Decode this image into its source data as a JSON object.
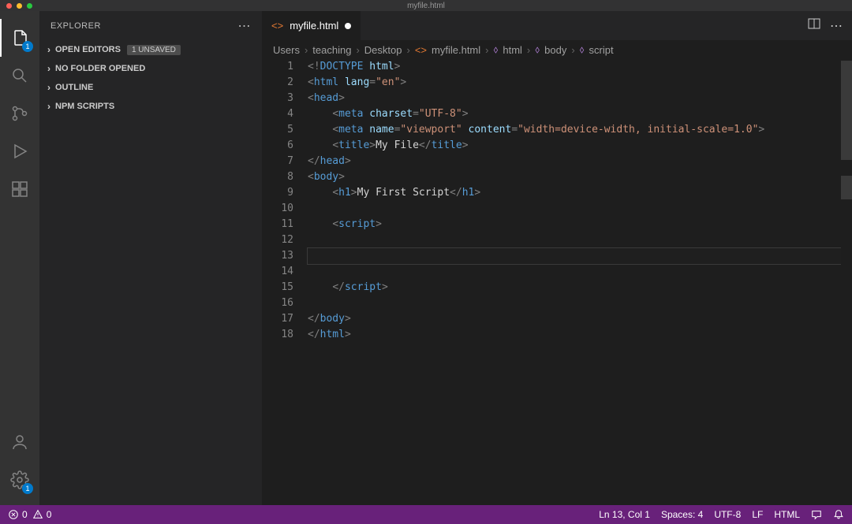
{
  "titlebar": {
    "title": "myfile.html"
  },
  "activityBar": {
    "explorerBadge": "1",
    "settingsBadge": "1"
  },
  "sidebar": {
    "title": "EXPLORER",
    "sections": {
      "openEditors": "OPEN EDITORS",
      "unsavedBadge": "1 UNSAVED",
      "noFolder": "NO FOLDER OPENED",
      "outline": "OUTLINE",
      "npmScripts": "NPM SCRIPTS"
    }
  },
  "tabs": {
    "active": {
      "label": "myfile.html"
    }
  },
  "breadcrumbs": {
    "parts": [
      "Users",
      "teaching",
      "Desktop",
      "myfile.html",
      "html",
      "body",
      "script"
    ]
  },
  "editor": {
    "lineNumbers": [
      "1",
      "2",
      "3",
      "4",
      "5",
      "6",
      "7",
      "8",
      "9",
      "10",
      "11",
      "12",
      "13",
      "14",
      "15",
      "16",
      "17",
      "18"
    ],
    "code": {
      "l1_doctype": "DOCTYPE",
      "l1_html": "html",
      "l2_tag": "html",
      "l2_attr": "lang",
      "l2_val": "\"en\"",
      "l3_tag": "head",
      "l4_tag": "meta",
      "l4_attr": "charset",
      "l4_val": "\"UTF-8\"",
      "l5_tag": "meta",
      "l5_attr1": "name",
      "l5_val1": "\"viewport\"",
      "l5_attr2": "content",
      "l5_val2": "\"width=device-width, initial-scale=1.0\"",
      "l6_tag": "title",
      "l6_text": "My File",
      "l7_tag": "head",
      "l8_tag": "body",
      "l9_tag": "h1",
      "l9_text": "My First Script",
      "l11_tag": "script",
      "l15_tag": "script",
      "l17_tag": "body",
      "l18_tag": "html"
    }
  },
  "statusbar": {
    "errors": "0",
    "warnings": "0",
    "lineCol": "Ln 13, Col 1",
    "spaces": "Spaces: 4",
    "encoding": "UTF-8",
    "eol": "LF",
    "language": "HTML"
  }
}
